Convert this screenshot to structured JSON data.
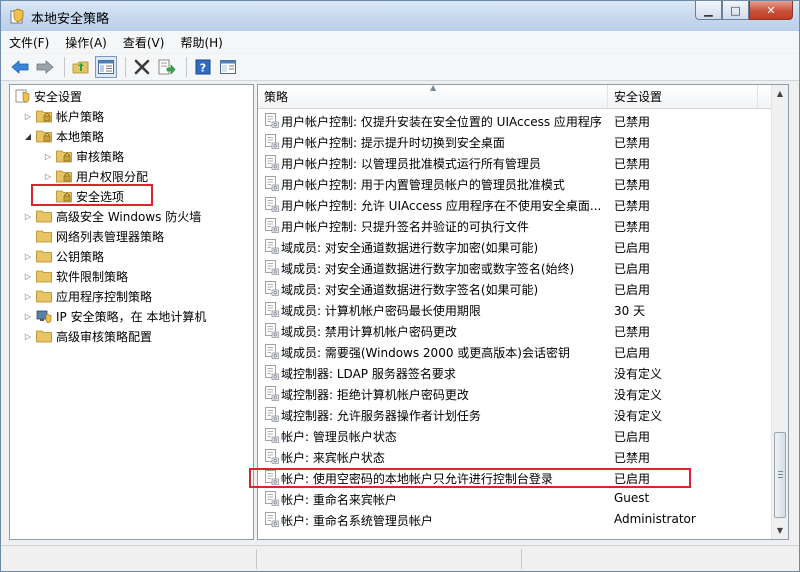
{
  "window": {
    "title": "本地安全策略"
  },
  "menu": [
    "文件(F)",
    "操作(A)",
    "查看(V)",
    "帮助(H)"
  ],
  "toolbar_icons": [
    "back-arrow-icon",
    "forward-arrow-icon",
    "up-folder-icon",
    "show-hide-tree-icon",
    "delete-icon",
    "export-list-icon",
    "help-icon",
    "properties-icon"
  ],
  "tree": [
    {
      "label": "安全设置",
      "level": 0,
      "arrow": "",
      "icon": "security-settings-icon"
    },
    {
      "label": "帐户策略",
      "level": 1,
      "arrow": "closed",
      "icon": "folder-icon"
    },
    {
      "label": "本地策略",
      "level": 1,
      "arrow": "open",
      "icon": "folder-icon"
    },
    {
      "label": "审核策略",
      "level": 2,
      "arrow": "closed",
      "icon": "folder-icon"
    },
    {
      "label": "用户权限分配",
      "level": 2,
      "arrow": "closed",
      "icon": "folder-icon"
    },
    {
      "label": "安全选项",
      "level": 2,
      "arrow": "",
      "icon": "folder-icon",
      "selected": true
    },
    {
      "label": "高级安全 Windows 防火墙",
      "level": 1,
      "arrow": "closed",
      "icon": "folder-icon"
    },
    {
      "label": "网络列表管理器策略",
      "level": 1,
      "arrow": "",
      "icon": "folder-icon"
    },
    {
      "label": "公钥策略",
      "level": 1,
      "arrow": "closed",
      "icon": "folder-icon"
    },
    {
      "label": "软件限制策略",
      "level": 1,
      "arrow": "closed",
      "icon": "folder-icon"
    },
    {
      "label": "应用程序控制策略",
      "level": 1,
      "arrow": "closed",
      "icon": "folder-icon"
    },
    {
      "label": "IP 安全策略，在 本地计算机",
      "level": 1,
      "arrow": "closed",
      "icon": "ip-security-icon"
    },
    {
      "label": "高级审核策略配置",
      "level": 1,
      "arrow": "closed",
      "icon": "folder-icon"
    }
  ],
  "columns": {
    "policy": "策略",
    "setting": "安全设置"
  },
  "policies": [
    {
      "policy": "用户帐户控制: 仅提升安装在安全位置的 UIAccess 应用程序",
      "setting": "已禁用"
    },
    {
      "policy": "用户帐户控制: 提示提升时切换到安全桌面",
      "setting": "已禁用"
    },
    {
      "policy": "用户帐户控制: 以管理员批准模式运行所有管理员",
      "setting": "已禁用"
    },
    {
      "policy": "用户帐户控制: 用于内置管理员帐户的管理员批准模式",
      "setting": "已禁用"
    },
    {
      "policy": "用户帐户控制: 允许 UIAccess 应用程序在不使用安全桌面...",
      "setting": "已禁用"
    },
    {
      "policy": "用户帐户控制: 只提升签名并验证的可执行文件",
      "setting": "已禁用"
    },
    {
      "policy": "域成员: 对安全通道数据进行数字加密(如果可能)",
      "setting": "已启用"
    },
    {
      "policy": "域成员: 对安全通道数据进行数字加密或数字签名(始终)",
      "setting": "已启用"
    },
    {
      "policy": "域成员: 对安全通道数据进行数字签名(如果可能)",
      "setting": "已启用"
    },
    {
      "policy": "域成员: 计算机帐户密码最长使用期限",
      "setting": "30 天"
    },
    {
      "policy": "域成员: 禁用计算机帐户密码更改",
      "setting": "已禁用"
    },
    {
      "policy": "域成员: 需要强(Windows 2000 或更高版本)会话密钥",
      "setting": "已启用"
    },
    {
      "policy": "域控制器: LDAP 服务器签名要求",
      "setting": "没有定义"
    },
    {
      "policy": "域控制器: 拒绝计算机帐户密码更改",
      "setting": "没有定义"
    },
    {
      "policy": "域控制器: 允许服务器操作者计划任务",
      "setting": "没有定义"
    },
    {
      "policy": "帐户: 管理员帐户状态",
      "setting": "已启用"
    },
    {
      "policy": "帐户: 来宾帐户状态",
      "setting": "已禁用"
    },
    {
      "policy": "帐户: 使用空密码的本地帐户只允许进行控制台登录",
      "setting": "已启用",
      "highlighted": true
    },
    {
      "policy": "帐户: 重命名来宾帐户",
      "setting": "Guest"
    },
    {
      "policy": "帐户: 重命名系统管理员帐户",
      "setting": "Administrator"
    }
  ],
  "colors": {
    "highlight_box": "#d9252b",
    "title_gradient": "#c4d7ee",
    "folder": "#e8c564"
  }
}
